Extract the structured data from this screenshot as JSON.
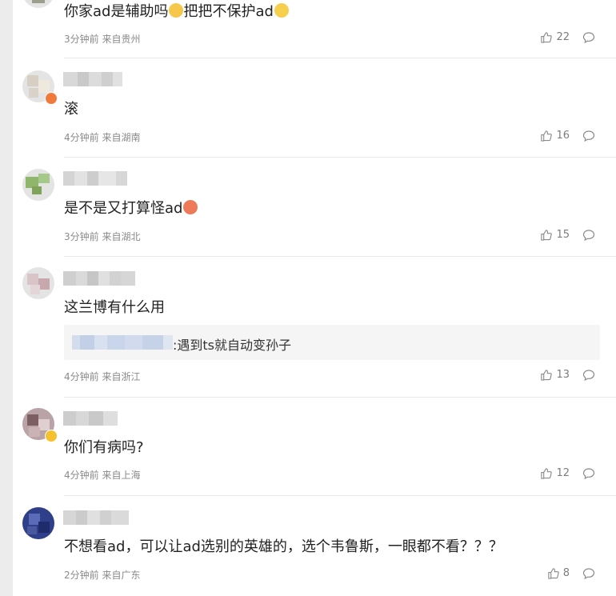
{
  "comments": [
    {
      "text": "你家ad是辅助吗",
      "text2": "把把不保护ad",
      "meta": "3分钟前 来自贵州",
      "likes": "22"
    },
    {
      "text": "滚",
      "meta": "4分钟前 来自湖南",
      "likes": "16"
    },
    {
      "text": "是不是又打算怪ad",
      "meta": "3分钟前 来自湖北",
      "likes": "15"
    },
    {
      "text": "这兰博有什么用",
      "reply_text": ":遇到ts就自动变孙子",
      "meta": "4分钟前 来自浙江",
      "likes": "13"
    },
    {
      "text": "你们有病吗?",
      "meta": "4分钟前 来自上海",
      "likes": "12"
    },
    {
      "text": "不想看ad，可以让ad选别的英雄的，选个韦鲁斯，一眼都不看？？？",
      "meta": "2分钟前 来自广东",
      "likes": "8"
    }
  ],
  "icons": {
    "like": "thumbs-up-icon",
    "reply": "comment-bubble-icon"
  },
  "colors": {
    "background": "#ececec",
    "card": "#ffffff",
    "meta_text": "#8a8a8a",
    "body_text": "#222222"
  }
}
